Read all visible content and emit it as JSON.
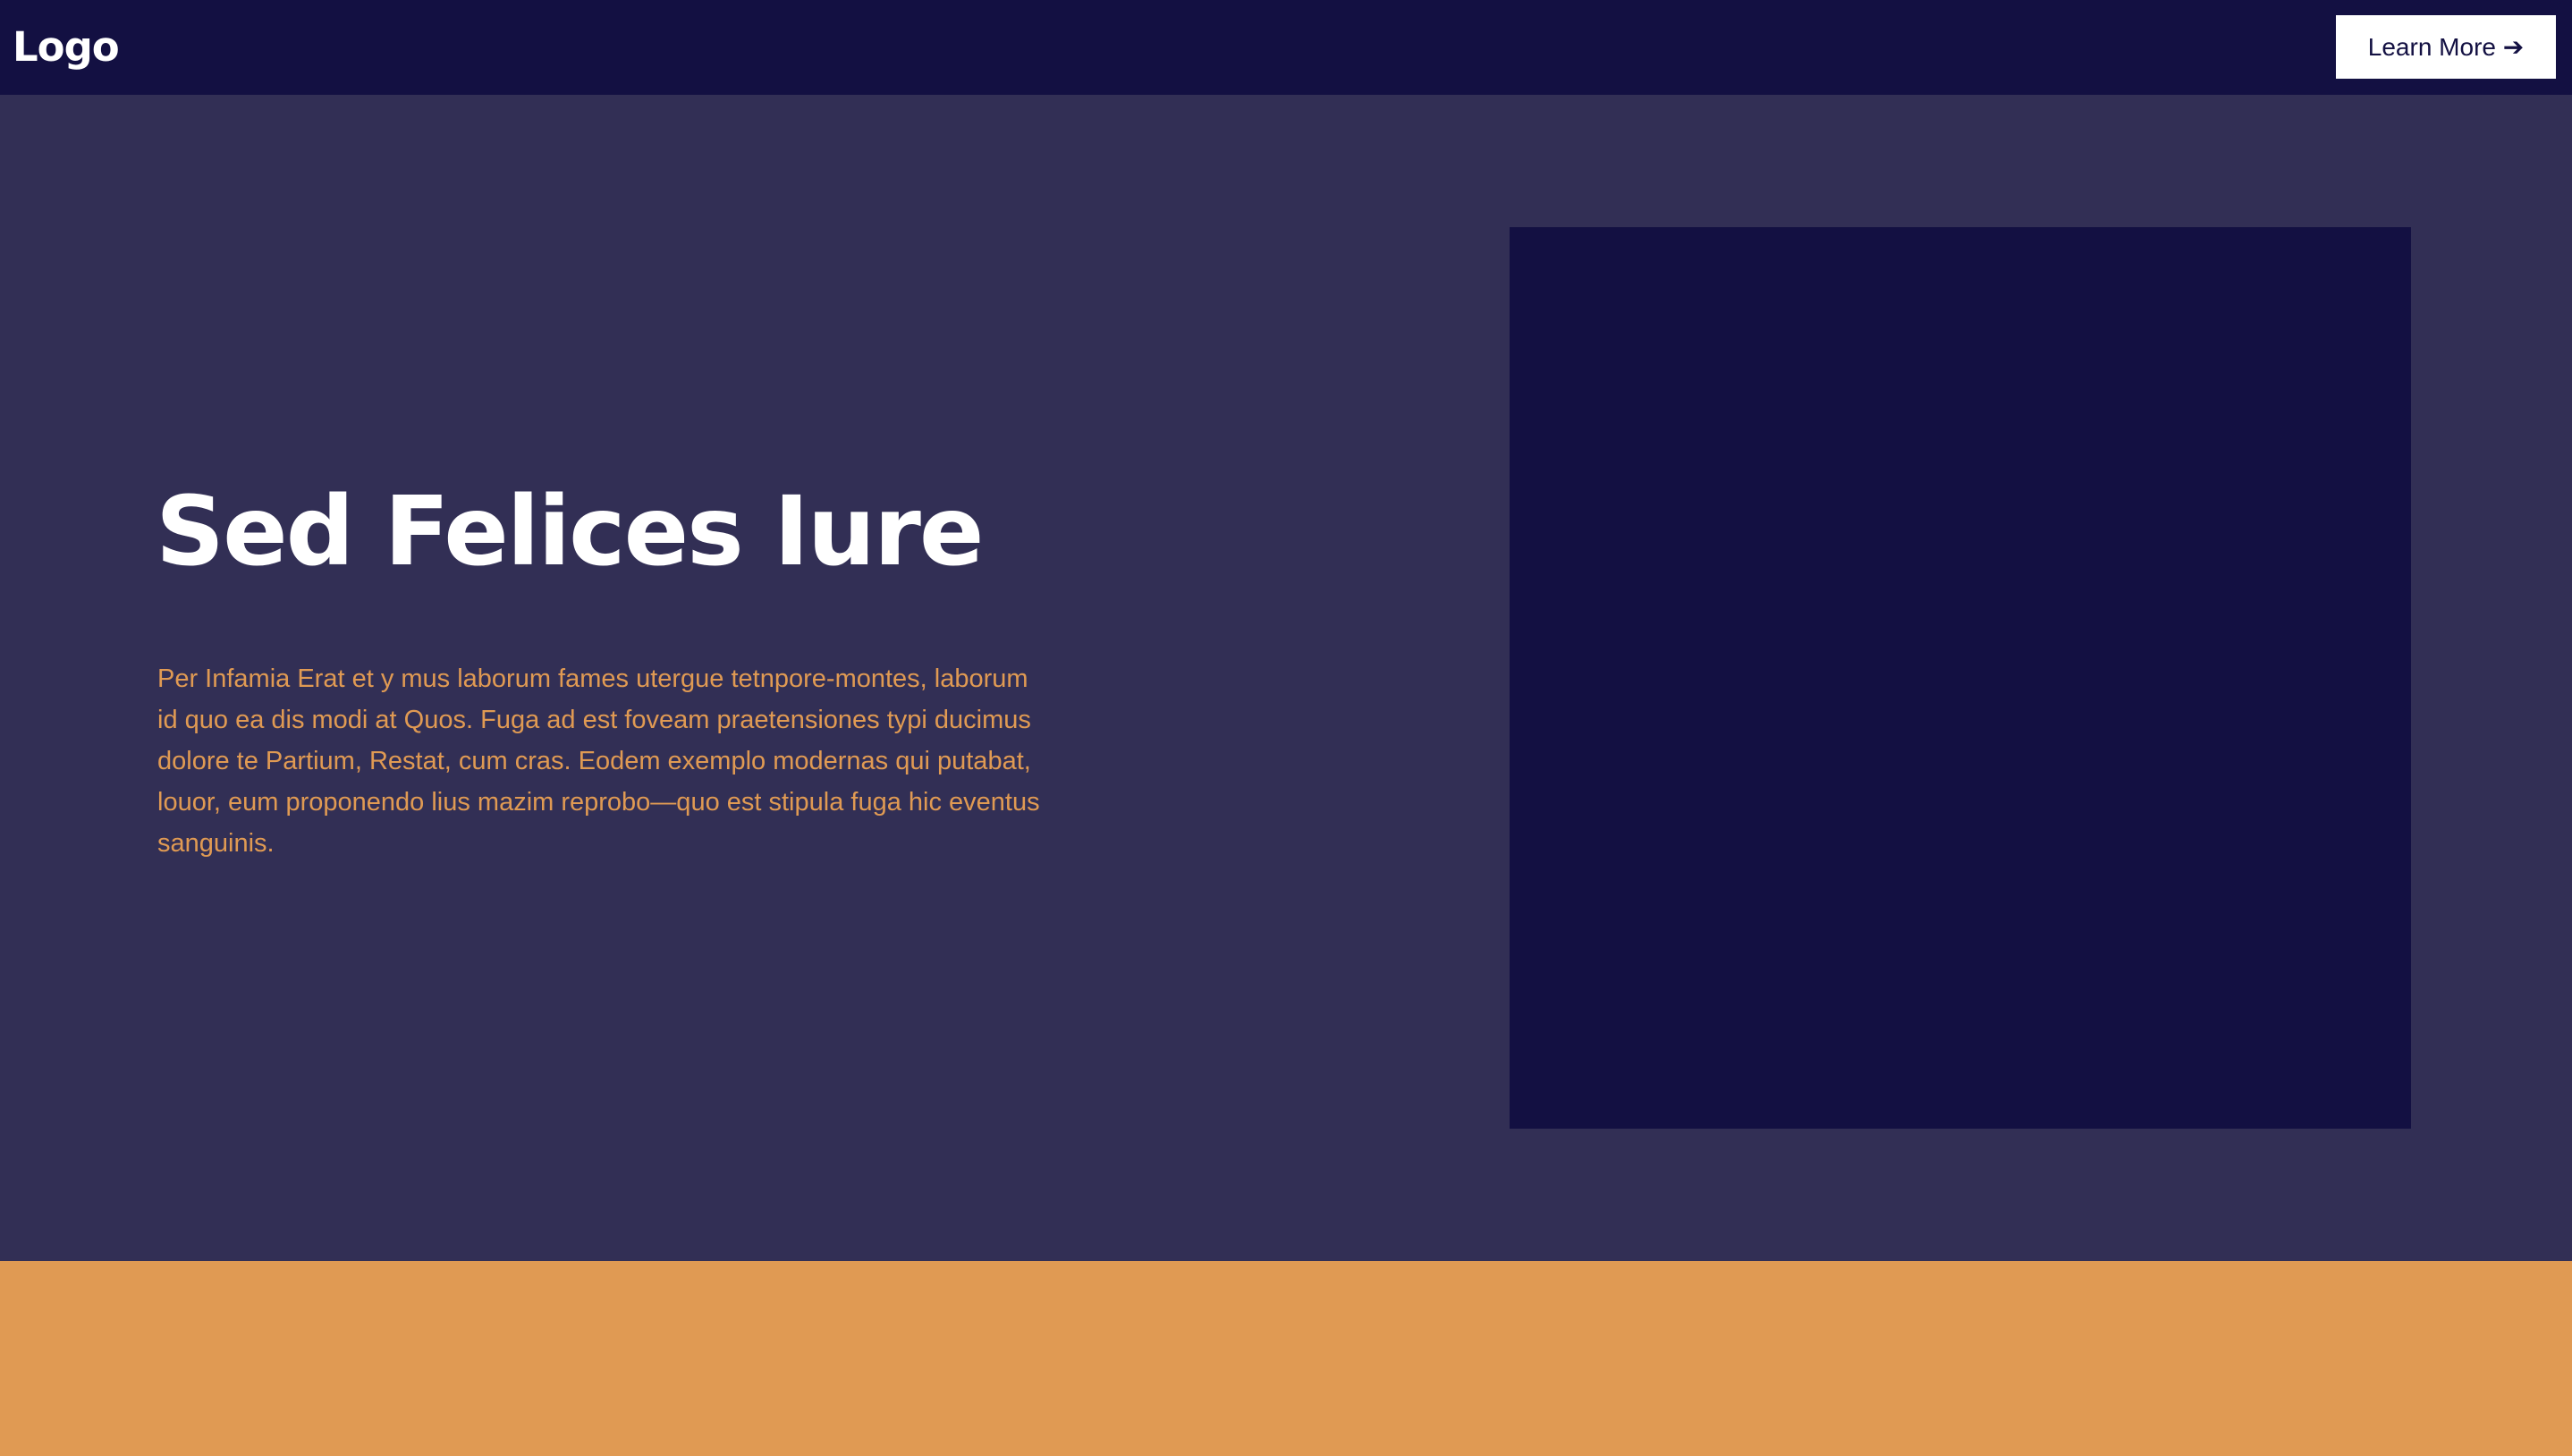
{
  "header": {
    "logo_text": "Logo",
    "cta_label": "Learn More ➔"
  },
  "hero": {
    "title": "Sed Felices Iure",
    "body": "Per Infamia Erat et y mus laborum fames utergue tetnpore-montes, laborum id quo ea dis modi at Quos. Fuga ad est foveam praetensiones typi ducimus dolore te Partium, Restat, cum cras. Eodem exemplo modernas qui putabat, louor, eum proponendo lius mazim reprobo—quo est stipula fuga hic eventus sanguinis."
  },
  "colors": {
    "nav_background": "#131042",
    "hero_background": "#322f55",
    "accent": "#e09a53",
    "button_background": "#ffffff"
  }
}
